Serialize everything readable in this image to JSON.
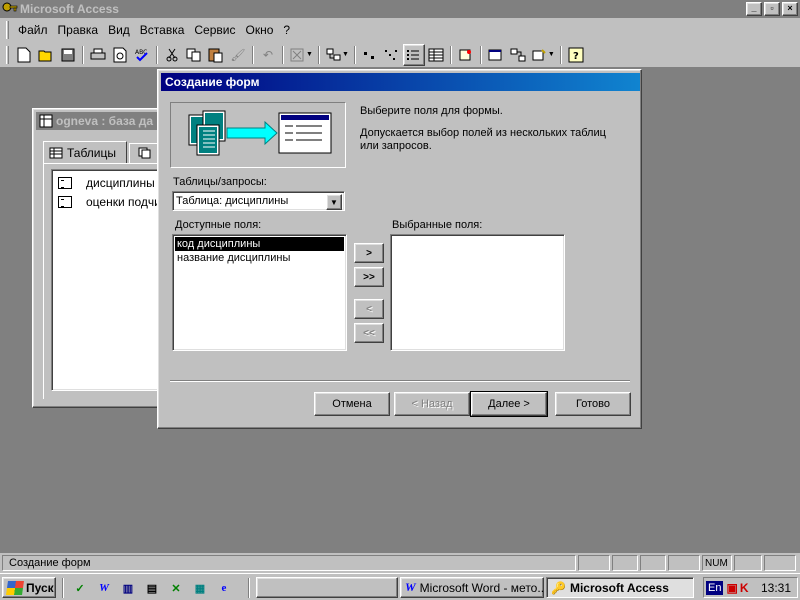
{
  "app": {
    "title": "Microsoft Access",
    "minimize": "_",
    "restore": "▫",
    "close": "×"
  },
  "menu": [
    "Файл",
    "Правка",
    "Вид",
    "Вставка",
    "Сервис",
    "Окно",
    "?"
  ],
  "toolbar": {
    "icons": [
      "new-icon",
      "open-icon",
      "save-icon",
      "print-icon",
      "print-preview-icon",
      "spelling-icon",
      "cut-icon",
      "copy-icon",
      "paste-icon",
      "format-painter-icon",
      "undo-icon",
      "office-links-icon",
      "analyze-icon",
      "large-icons-icon",
      "small-icons-icon",
      "list-icon",
      "details-icon",
      "code-icon",
      "properties-icon",
      "relationships-icon",
      "new-object-icon",
      "help-icon"
    ]
  },
  "db_window": {
    "title": "ognevа : база да",
    "tab_tables": "Таблицы",
    "items": [
      "дисциплины",
      "оценки подчи"
    ]
  },
  "dialog": {
    "title": "Создание форм",
    "instruction": "Выберите поля для формы.",
    "hint_line1": "Допускается выбор полей из нескольких таблиц",
    "hint_line2": "или запросов.",
    "tables_label": "Таблицы/запросы:",
    "tables_value": "Таблица: дисциплины",
    "available_label": "Доступные поля:",
    "selected_label": "Выбранные поля:",
    "available_fields": [
      "код дисциплины",
      "название дисциплины"
    ],
    "selected_index": 0,
    "selected_fields": [],
    "move_one": ">",
    "move_all": ">>",
    "remove_one": "<",
    "remove_all": "<<",
    "cancel": "Отмена",
    "back": "< Назад",
    "next": "Далее >",
    "finish": "Готово"
  },
  "status": {
    "text": "Создание форм",
    "num": "NUM"
  },
  "taskbar": {
    "start": "Пуск",
    "tasks": [
      "Microsoft Word - мето...",
      "Microsoft Access"
    ],
    "lang": "En",
    "clock": "13:31"
  }
}
